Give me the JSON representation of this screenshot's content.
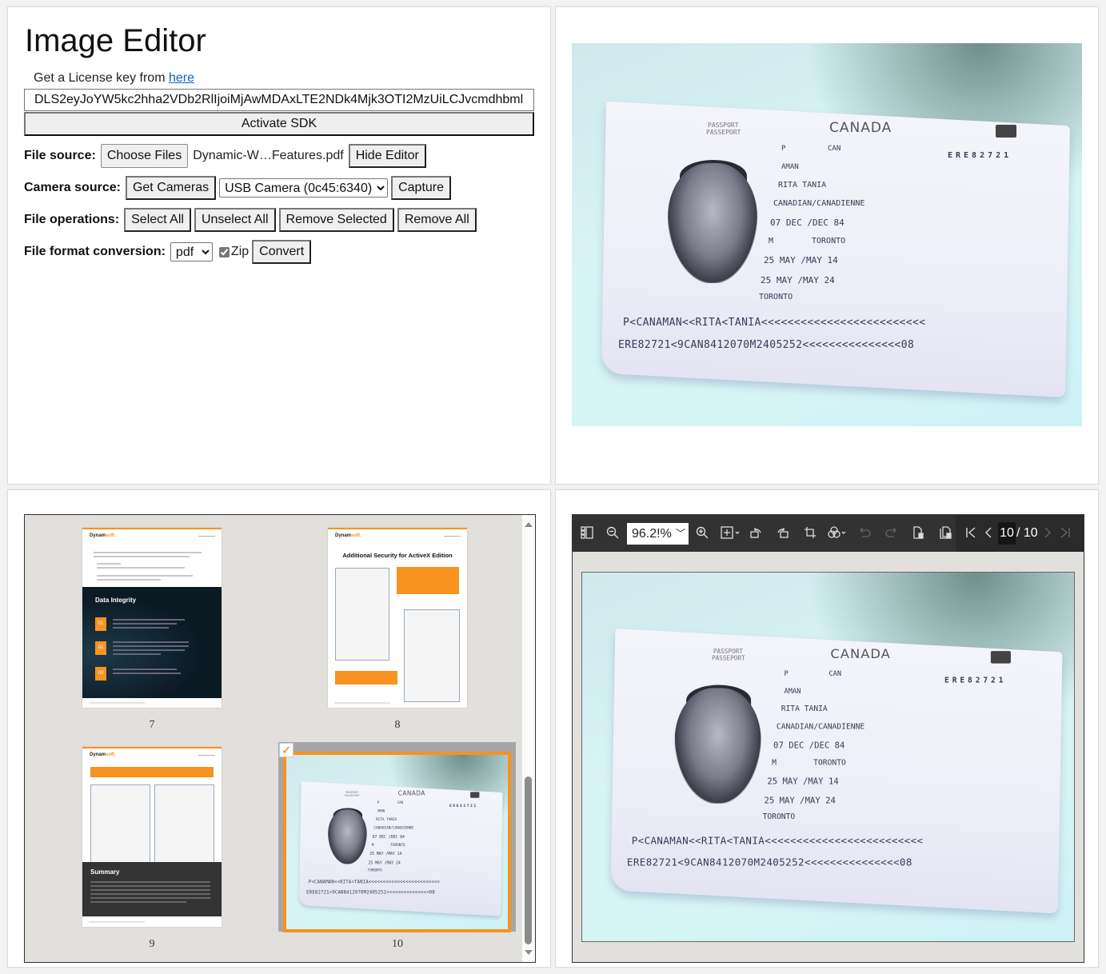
{
  "form": {
    "title": "Image Editor",
    "license_prefix": "Get a License key from ",
    "license_link": "here",
    "license_value": "DLS2eyJoYW5kc2hha2VDb2RlIjoiMjAwMDAxLTE2NDk4Mjk3OTI2MzUiLCJvcmdhbml",
    "activate_label": "Activate SDK",
    "file_source_label": "File source:",
    "choose_files_label": "Choose Files",
    "file_name": "Dynamic-W…Features.pdf",
    "hide_editor_label": "Hide Editor",
    "camera_source_label": "Camera source:",
    "get_cameras_label": "Get Cameras",
    "camera_selected": "USB Camera (0c45:6340)",
    "capture_label": "Capture",
    "file_ops_label": "File operations:",
    "select_all_label": "Select All",
    "unselect_all_label": "Unselect All",
    "remove_selected_label": "Remove Selected",
    "remove_all_label": "Remove All",
    "format_label": "File format conversion:",
    "format_selected": "pdf",
    "zip_label": "Zip",
    "zip_checked": true,
    "convert_label": "Convert"
  },
  "passport": {
    "header_en": "PASSPORT",
    "header_fr": "PASSEPORT",
    "country": "CANADA",
    "type": "P",
    "issuing_country": "CAN",
    "passport_no": "ERE82721",
    "surname": "AMAN",
    "given_names": "RITA TANIA",
    "nationality": "CANADIAN/CANADIENNE",
    "dob": "07 DEC /DEC  84",
    "sex": "M",
    "place_of_birth": "TORONTO",
    "issue_date": "25 MAY /MAY  14",
    "expiry_date": "25 MAY /MAY  24",
    "authority": "TORONTO",
    "mrz_line1": "P<CANAMAN<<RITA<TANIA<<<<<<<<<<<<<<<<<<<<<<<<<",
    "mrz_line2": "ERE82721<9CAN8412070M2405252<<<<<<<<<<<<<<<08"
  },
  "thumbnails": [
    {
      "page": "7",
      "logo_a": "Dynam",
      "logo_b": "soft.",
      "dark_title": "Data Integrity",
      "boxes": [
        "01",
        "02",
        "03"
      ],
      "selected": false
    },
    {
      "page": "8",
      "logo_a": "Dynam",
      "logo_b": "soft.",
      "title": "Additional Security for ActiveX Edition",
      "selected": false
    },
    {
      "page": "9",
      "logo_a": "Dynam",
      "logo_b": "soft.",
      "dark_title": "Summary",
      "selected": false
    },
    {
      "page": "10",
      "selected": true
    }
  ],
  "viewer": {
    "zoom_value": "96.2!%",
    "page_current": "10",
    "page_total": "/ 10",
    "icons": [
      "thumbnail-panel-icon",
      "zoom-out-icon",
      "zoom-in-icon",
      "fit-icon",
      "rotate-left-icon",
      "rotate-right-icon",
      "crop-icon",
      "filter-icon",
      "undo-icon",
      "redo-icon",
      "delete-page-icon",
      "delete-all-icon",
      "first-page-icon",
      "prev-page-icon",
      "next-page-icon",
      "last-page-icon"
    ]
  },
  "colors": {
    "accent": "#f7931e",
    "toolbar_bg": "#323232",
    "viewer_bg": "#e2e0dd"
  }
}
